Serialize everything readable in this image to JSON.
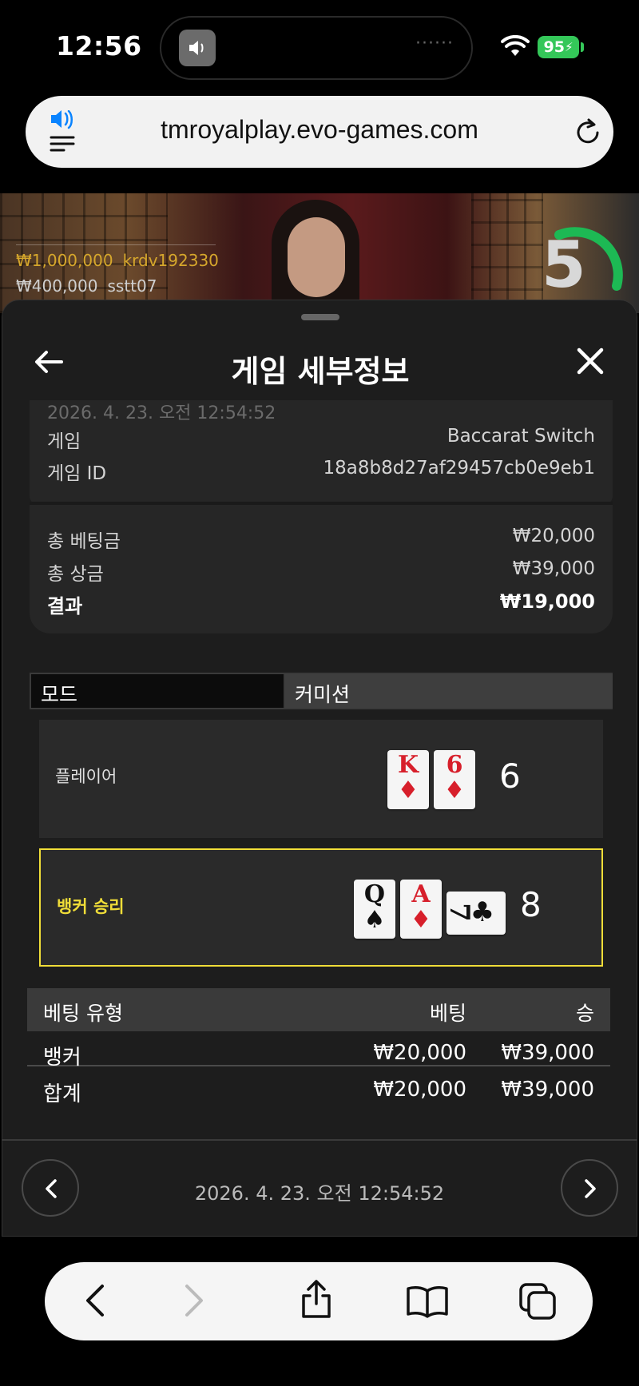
{
  "status_bar": {
    "time": "12:56",
    "battery": "95"
  },
  "browser": {
    "url": "tmroyalplay.evo-games.com"
  },
  "video": {
    "winners": [
      {
        "amount": "₩1,000,000",
        "user": "krdv192330"
      },
      {
        "amount": "₩400,000",
        "user": "sstt07"
      }
    ],
    "timer": "5"
  },
  "panel": {
    "title": "게임 세부정보",
    "faded_timestamp": "2026. 4. 23. 오전 12:54:52",
    "info": [
      {
        "label": "게임",
        "value": "Baccarat Switch"
      },
      {
        "label": "게임 ID",
        "value": "18a8b8d27af29457cb0e9eb1"
      }
    ],
    "summary": [
      {
        "label": "총 베팅금",
        "value": "₩20,000"
      },
      {
        "label": "총 상금",
        "value": "₩39,000"
      },
      {
        "label": "결과",
        "value": "₩19,000"
      }
    ],
    "mode": {
      "label": "모드",
      "value": "커미션"
    },
    "hands": {
      "player": {
        "label": "플레이어",
        "score": "6",
        "cards": [
          {
            "rank": "K",
            "suit": "♦",
            "color": "#d71f2b"
          },
          {
            "rank": "6",
            "suit": "♦",
            "color": "#d71f2b"
          }
        ]
      },
      "banker": {
        "label": "뱅커 승리",
        "score": "8",
        "cards": [
          {
            "rank": "Q",
            "suit": "♠",
            "color": "#111111"
          },
          {
            "rank": "A",
            "suit": "♦",
            "color": "#d71f2b"
          },
          {
            "rank": "7",
            "suit": "♣",
            "color": "#111111"
          }
        ]
      }
    },
    "bets": {
      "headers": {
        "type": "베팅 유형",
        "bet": "베팅",
        "win": "승"
      },
      "rows": [
        {
          "type": "뱅커",
          "bet": "₩20,000",
          "win": "₩39,000"
        },
        {
          "type": "합계",
          "bet": "₩20,000",
          "win": "₩39,000"
        }
      ]
    },
    "footer_timestamp": "2026. 4. 23. 오전 12:54:52"
  },
  "colors": {
    "accent_yellow": "#f0dd38",
    "win_gold": "#d6a72c",
    "timer_green": "#1db954",
    "battery_green": "#34c759",
    "link_blue": "#0a84ff"
  }
}
